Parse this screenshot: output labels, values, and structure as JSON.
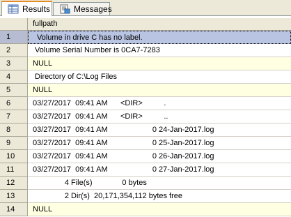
{
  "tabs": [
    {
      "label": "Results",
      "icon": "grid-icon",
      "active": true
    },
    {
      "label": "Messages",
      "icon": "document-icon",
      "active": false
    }
  ],
  "grid": {
    "column": "fullpath",
    "rows": [
      {
        "num": "1",
        "value": "Volume in drive C has no label.",
        "selected": true
      },
      {
        "num": "2",
        "value": " Volume Serial Number is 0CA7-7283"
      },
      {
        "num": "3",
        "value": "NULL",
        "null": true
      },
      {
        "num": "4",
        "value": " Directory of C:\\Log Files"
      },
      {
        "num": "5",
        "value": "NULL",
        "null": true
      },
      {
        "num": "6",
        "value": "03/27/2017  09:41 AM      <DIR>          ."
      },
      {
        "num": "7",
        "value": "03/27/2017  09:41 AM      <DIR>          .."
      },
      {
        "num": "8",
        "value": "03/27/2017  09:41 AM                     0 24-Jan-2017.log"
      },
      {
        "num": "9",
        "value": "03/27/2017  09:41 AM                     0 25-Jan-2017.log"
      },
      {
        "num": "10",
        "value": "03/27/2017  09:41 AM                     0 26-Jan-2017.log"
      },
      {
        "num": "11",
        "value": "03/27/2017  09:41 AM                     0 27-Jan-2017.log"
      },
      {
        "num": "12",
        "value": "               4 File(s)              0 bytes"
      },
      {
        "num": "13",
        "value": "               2 Dir(s)  20,171,354,112 bytes free"
      },
      {
        "num": "14",
        "value": "NULL",
        "null": true
      }
    ]
  },
  "colors": {
    "selection": "#b9c4e3",
    "null_background": "#ffffe1",
    "header_background": "#ece9d8",
    "active_tab_accent": "#e68b2c"
  }
}
